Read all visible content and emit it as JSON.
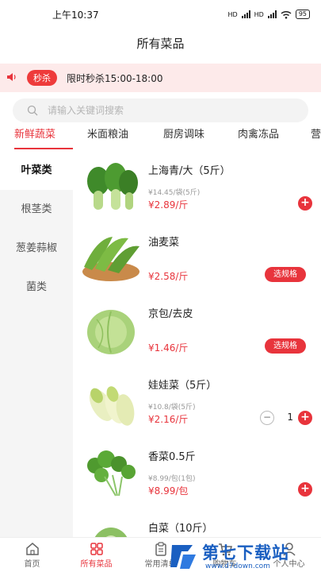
{
  "status_bar": {
    "time": "上午10:37",
    "network1": "HD",
    "network2": "HD",
    "battery": "95"
  },
  "header": {
    "title": "所有菜品"
  },
  "promo": {
    "tag": "秒杀",
    "message": "限时秒杀15:00-18:00"
  },
  "search": {
    "placeholder": "请输入关键词搜索"
  },
  "categories": [
    "新鲜蔬菜",
    "米面粮油",
    "厨房调味",
    "肉禽冻品",
    "营"
  ],
  "active_category": "新鲜蔬菜",
  "sidebar": {
    "items": [
      "叶菜类",
      "根茎类",
      "葱姜蒜椒",
      "菌类"
    ],
    "active": "叶菜类"
  },
  "products": [
    {
      "name": "上海青/大（5斤）",
      "sub": "¥14.45/袋(5斤)",
      "price": "¥2.89/斤",
      "action": "add",
      "add_label": "+"
    },
    {
      "name": "油麦菜",
      "sub": "",
      "price": "¥2.58/斤",
      "action": "spec",
      "spec_label": "选规格"
    },
    {
      "name": "京包/去皮",
      "sub": "",
      "price": "¥1.46/斤",
      "action": "spec",
      "spec_label": "选规格"
    },
    {
      "name": "娃娃菜（5斤）",
      "sub": "¥10.8/袋(5斤)",
      "price": "¥2.16/斤",
      "action": "stepper",
      "minus_label": "−",
      "qty": "1",
      "add_label": "+"
    },
    {
      "name": "香菜0.5斤",
      "sub": "¥8.99/包(1包)",
      "price": "¥8.99/包",
      "action": "add",
      "add_label": "+"
    },
    {
      "name": "白菜（10斤）",
      "sub": "",
      "price": "",
      "action": "none"
    }
  ],
  "tabbar": {
    "items": [
      "首页",
      "所有菜品",
      "常用清单",
      "购物车",
      "个人中心"
    ],
    "active": "所有菜品"
  },
  "watermark": {
    "title": "第七下载站",
    "url": "www.d7down.com"
  },
  "colors": {
    "accent": "#e8343c",
    "promo_bg": "#fdeaea",
    "sidebar_bg": "#f5f5f5",
    "watermark": "#1a5fc1"
  }
}
